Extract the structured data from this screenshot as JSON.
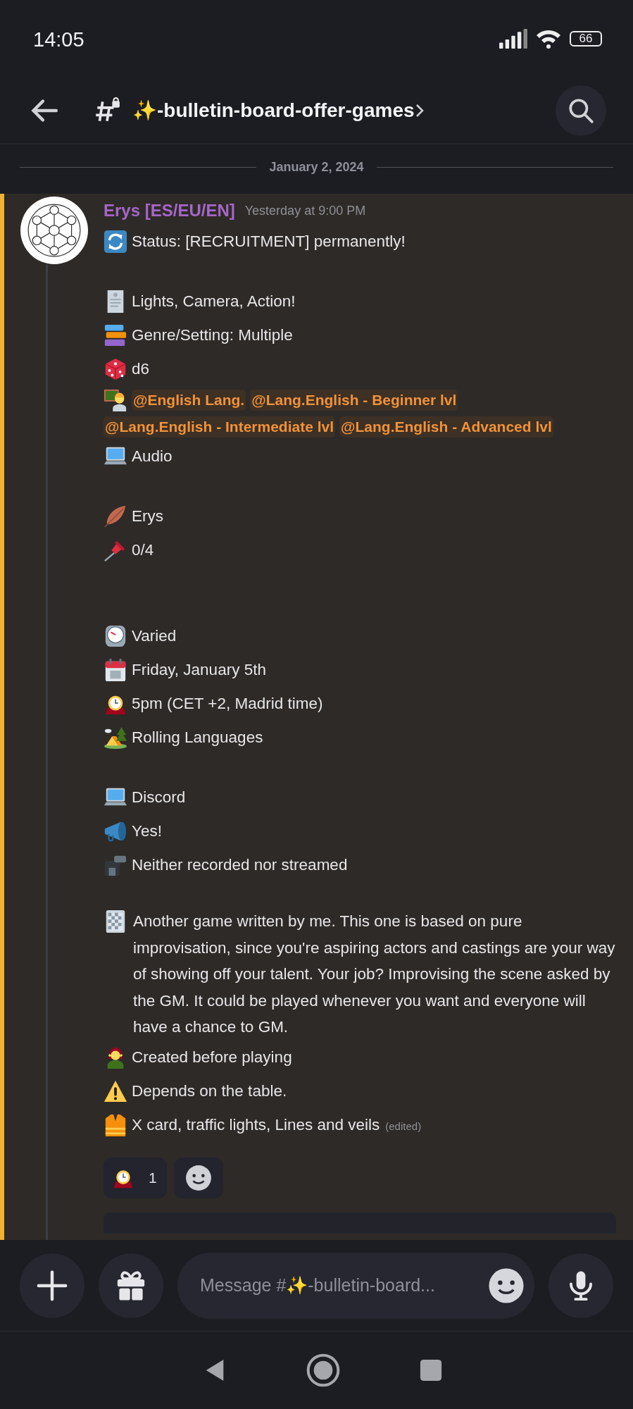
{
  "status_bar": {
    "time": "14:05",
    "battery": "66"
  },
  "header": {
    "channel": "✨-bulletin-board-offer-games"
  },
  "date_divider": "January 2, 2024",
  "message": {
    "author": "Erys [ES/EU/EN]",
    "timestamp": "Yesterday at 9:00 PM",
    "lines": [
      {
        "kind": "emoji",
        "text": "Status: [RECRUITMENT] permanently!"
      },
      {
        "kind": "blank"
      },
      {
        "kind": "emoji",
        "text": "Lights, Camera, Action!"
      },
      {
        "kind": "emoji",
        "text": "Genre/Setting: Multiple"
      },
      {
        "kind": "emoji",
        "text": "d6"
      },
      {
        "kind": "mentions",
        "mentions": [
          "@English Lang.",
          "@Lang.English - Beginner lvl",
          "@Lang.English - Intermediate lvl",
          "@Lang.English - Advanced lvl"
        ]
      },
      {
        "kind": "emoji",
        "text": "Audio"
      },
      {
        "kind": "blank"
      },
      {
        "kind": "emoji",
        "text": "Erys"
      },
      {
        "kind": "emoji",
        "text": "0/4"
      },
      {
        "kind": "blank"
      },
      {
        "kind": "blank"
      },
      {
        "kind": "emoji",
        "text": "Varied"
      },
      {
        "kind": "emoji",
        "text": "Friday, January 5th"
      },
      {
        "kind": "emoji",
        "text": "5pm (CET +2, Madrid time)"
      },
      {
        "kind": "emoji",
        "text": "Rolling Languages"
      },
      {
        "kind": "blank"
      },
      {
        "kind": "emoji",
        "text": "Discord"
      },
      {
        "kind": "emoji",
        "text": "Yes!"
      },
      {
        "kind": "emoji",
        "text": "Neither recorded nor streamed"
      },
      {
        "kind": "blank"
      },
      {
        "kind": "paragraph",
        "text": "Another game written by me. This one is based on pure improvisation, since you're aspiring actors and castings are your way of showing off your talent. Your job? Improvising the scene asked by the GM. It could be played whenever you want and everyone will have a chance to GM."
      },
      {
        "kind": "emoji",
        "text": "Created before playing"
      },
      {
        "kind": "emoji",
        "text": "Depends on the table."
      },
      {
        "kind": "emoji",
        "text": "X card, traffic lights, Lines and veils",
        "edited": "(edited)"
      }
    ],
    "reactions": [
      {
        "count": "1"
      }
    ]
  },
  "composer": {
    "placeholder": "Message #✨-bulletin-board..."
  }
}
